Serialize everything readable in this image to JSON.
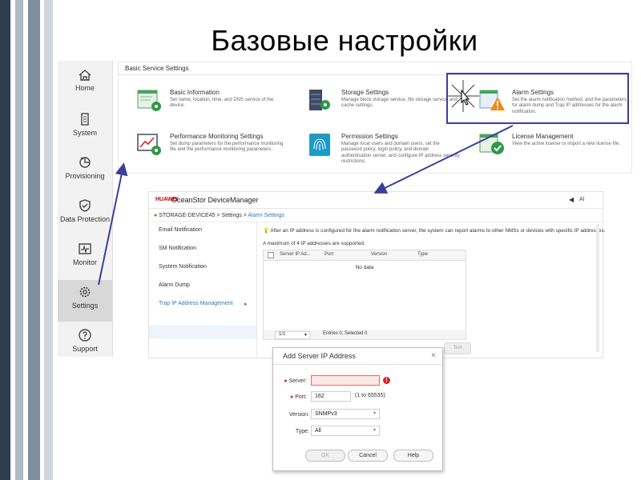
{
  "slide": {
    "title": "Базовые настройки"
  },
  "nav": [
    {
      "label": "Home",
      "icon": "home-icon"
    },
    {
      "label": "System",
      "icon": "system-icon"
    },
    {
      "label": "Provisioning",
      "icon": "provisioning-icon"
    },
    {
      "label": "Data Protection",
      "icon": "shield-icon"
    },
    {
      "label": "Monitor",
      "icon": "monitor-icon"
    },
    {
      "label": "Settings",
      "icon": "gear-icon"
    },
    {
      "label": "Support",
      "icon": "help-icon"
    }
  ],
  "service_panel": {
    "title": "Basic Service Settings",
    "items": [
      {
        "name": "Basic Information",
        "desc": "Set name, location, time, and DNS service of the device.",
        "icon": "basic-info-icon"
      },
      {
        "name": "Storage Settings",
        "desc": "Manage block storage service, file storage service and cache settings.",
        "icon": "storage-settings-icon"
      },
      {
        "name": "Alarm Settings",
        "desc": "Set the alarm notification method, and the parameters for alarm dump and Trap IP addresses for the alarm notification.",
        "icon": "alarm-warning-icon"
      },
      {
        "name": "Performance Monitoring Settings",
        "desc": "Set dump parameters for the performance monitoring file and the performance monitoring parameters.",
        "icon": "performance-chart-icon"
      },
      {
        "name": "Permission Settings",
        "desc": "Manage local users and domain users, set the password policy, login policy, and domain authentication server, and configure IP address security restrictions.",
        "icon": "fingerprint-icon"
      },
      {
        "name": "License Management",
        "desc": "View the active license or import a new license file.",
        "icon": "license-check-icon"
      }
    ]
  },
  "device_manager": {
    "logo": "HUAWEI",
    "app_name": "OceanStor DeviceManager",
    "user": "Al",
    "breadcrumb": {
      "device": "STORAGE-DEVICE45",
      "sep1": ">",
      "section": "Settings",
      "sep2": ">",
      "page": "Alarm Settings"
    },
    "menu": [
      {
        "label": "Email Notification"
      },
      {
        "label": "SM Notification"
      },
      {
        "label": "System Notification"
      },
      {
        "label": "Alarm Dump"
      },
      {
        "label": "Trap IP Address Management"
      }
    ],
    "menu_arrow": "▸",
    "note": "After an IP address is configured for the alarm notification server, the system can report alarms to other NMSs or devices with specific IP addresses.",
    "limit_note": "A maximum of 4 IP addresses are supported.",
    "table": {
      "columns": [
        "Server IP Ad...",
        "Port",
        "Version",
        "Type"
      ],
      "empty_text": "No data"
    },
    "pager": {
      "page": "1/1",
      "status": "Entries 0, Selected 0"
    },
    "test_button": "Test"
  },
  "dialog": {
    "title": "Add Server IP Address",
    "close": "×",
    "fields": {
      "server": {
        "label": "Server:",
        "value": ""
      },
      "port": {
        "label": "Port:",
        "value": "162",
        "hint": "(1 to 65535)"
      },
      "version": {
        "label": "Version:",
        "value": "SNMPv3"
      },
      "type": {
        "label": "Type:",
        "value": "All"
      }
    },
    "buttons": {
      "ok": "OK",
      "cancel": "Cancel",
      "help": "Help"
    }
  },
  "colors": {
    "accent": "#3b3f9a",
    "stripe_dark": "#2c3e50",
    "stripe_light": "#aab6c2",
    "link": "#2a7ab8",
    "error": "#d8232a"
  }
}
